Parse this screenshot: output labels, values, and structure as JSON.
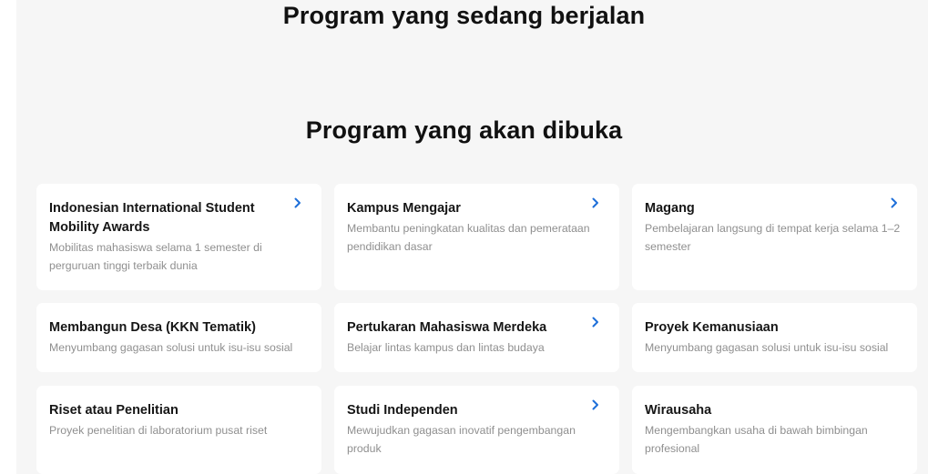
{
  "sections": {
    "running_title": "Program yang sedang berjalan",
    "upcoming_title": "Program yang akan dibuka"
  },
  "programs": [
    {
      "title": "Indonesian International Student Mobility Awards",
      "description": "Mobilitas mahasiswa selama 1 semester di perguruan tinggi terbaik dunia",
      "has_arrow": true
    },
    {
      "title": "Kampus Mengajar",
      "description": "Membantu peningkatan kualitas dan pemerataan pendidikan dasar",
      "has_arrow": true
    },
    {
      "title": "Magang",
      "description": "Pembelajaran langsung di tempat kerja selama 1–2 semester",
      "has_arrow": true
    },
    {
      "title": "Membangun Desa (KKN Tematik)",
      "description": "Menyumbang gagasan solusi untuk isu-isu sosial",
      "has_arrow": false
    },
    {
      "title": "Pertukaran Mahasiswa Merdeka",
      "description": "Belajar lintas kampus dan lintas budaya",
      "has_arrow": true
    },
    {
      "title": "Proyek Kemanusiaan",
      "description": "Menyumbang gagasan solusi untuk isu-isu sosial",
      "has_arrow": false
    },
    {
      "title": "Riset atau Penelitian",
      "description": "Proyek penelitian di laboratorium pusat riset",
      "has_arrow": false
    },
    {
      "title": "Studi Independen",
      "description": "Mewujudkan gagasan inovatif pengembangan produk",
      "has_arrow": true
    },
    {
      "title": "Wirausaha",
      "description": "Mengembangkan usaha di bawah bimbingan profesional",
      "has_arrow": false
    }
  ],
  "icons": {
    "arrow": "chevron-right-icon"
  },
  "colors": {
    "accent": "#1e6fd9",
    "panel_background": "#f6f6f6",
    "card_background": "#ffffff",
    "title_text": "#161616",
    "description_text": "#8f8f8f"
  }
}
